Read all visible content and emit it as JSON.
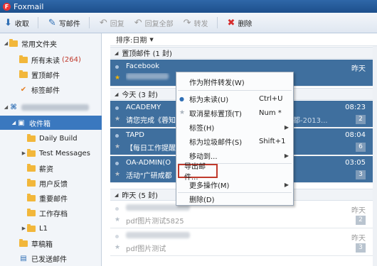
{
  "app": {
    "title": "Foxmail",
    "logo_letter": "F"
  },
  "toolbar": {
    "receive": "收取",
    "compose": "写邮件",
    "reply": "回复",
    "reply_all": "回复全部",
    "forward": "转发",
    "delete": "删除"
  },
  "sidebar": {
    "common": "常用文件夹",
    "unread": "所有未读",
    "unread_count": "(264)",
    "pinned": "置顶邮件",
    "tagged": "标签邮件",
    "inbox": "收件箱",
    "folders": [
      "Daily Build",
      "Test Messages",
      "薪资",
      "用户反馈",
      "重要邮件",
      "工作存档",
      "L1"
    ],
    "drafts": "草稿箱",
    "sent": "已发送邮件"
  },
  "list": {
    "sort_label": "排序:日期",
    "group_pinned": "置顶邮件 (1 封)",
    "group_today": "今天 (3 封)",
    "group_yesterday": "昨天 (5 封)",
    "items": [
      {
        "sender": "Facebook",
        "subject": "",
        "time": "昨天",
        "badge": ""
      },
      {
        "sender": "ACADEMY",
        "subject": "请您完成《蓉知",
        "subject_tail": "5解析-成都-2013...",
        "time": "08:23",
        "badge": "2"
      },
      {
        "sender": "TAPD",
        "subject": "【每日工作提醒",
        "subject_tail": "",
        "time": "08:04",
        "badge": "6"
      },
      {
        "sender": "OA-ADMIN(O",
        "subject": "活动\"广研成都",
        "subject_tail": "",
        "time": "03:05",
        "badge": "3"
      },
      {
        "sender": "",
        "subject": "pdf图片测试5825",
        "time": "昨天",
        "badge": "2"
      },
      {
        "sender": "",
        "subject": "pdf图片测试",
        "time": "昨天",
        "badge": "3"
      }
    ]
  },
  "context_menu": {
    "items": [
      {
        "label": "作为附件转发(W)",
        "shortcut": "",
        "submenu": false
      },
      {
        "label": "标为未读(U)",
        "shortcut": "Ctrl+U",
        "submenu": false
      },
      {
        "label": "取消星标置顶(T)",
        "shortcut": "Num *",
        "submenu": false
      },
      {
        "label": "标签(H)",
        "shortcut": "",
        "submenu": true
      },
      {
        "label": "标为垃圾邮件(S)",
        "shortcut": "Shift+1",
        "submenu": false
      },
      {
        "label": "移动到...",
        "shortcut": "",
        "submenu": true
      },
      {
        "label": "导出邮件...",
        "shortcut": "",
        "submenu": false
      },
      {
        "label": "更多操作(M)",
        "shortcut": "",
        "submenu": true
      },
      {
        "label": "删除(D)",
        "shortcut": "",
        "submenu": false
      }
    ]
  },
  "colors": {
    "accent": "#3a78bf",
    "highlight_border": "#c0392b",
    "selected_row": "#3f6f9e"
  }
}
